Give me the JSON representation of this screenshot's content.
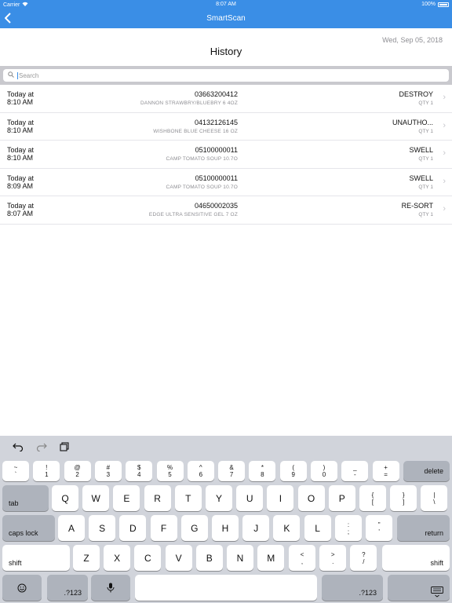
{
  "status_bar": {
    "carrier": "Carrier",
    "time": "8:07 AM",
    "battery": "100%"
  },
  "nav": {
    "title": "SmartScan",
    "back_icon": "chevron-left-icon"
  },
  "header": {
    "date": "Wed, Sep 05, 2018",
    "title": "History"
  },
  "search": {
    "placeholder": "Search"
  },
  "history": [
    {
      "when_line1": "Today at",
      "when_line2": "8:10 AM",
      "code": "03663200412",
      "desc": "DANNON STRAWBRY/BLUEBRY 6 4OZ",
      "status": "DESTROY",
      "qty": "QTY 1"
    },
    {
      "when_line1": "Today at",
      "when_line2": "8:10 AM",
      "code": "04132126145",
      "desc": "WISHBONE BLUE CHEESE 16 OZ",
      "status": "UNAUTHO...",
      "qty": "QTY 1"
    },
    {
      "when_line1": "Today at",
      "when_line2": "8:10 AM",
      "code": "05100000011",
      "desc": "CAMP TOMATO SOUP 10.7O",
      "status": "SWELL",
      "qty": "QTY 1"
    },
    {
      "when_line1": "Today at",
      "when_line2": "8:09 AM",
      "code": "05100000011",
      "desc": "CAMP TOMATO SOUP 10.7O",
      "status": "SWELL",
      "qty": "QTY 1"
    },
    {
      "when_line1": "Today at",
      "when_line2": "8:07 AM",
      "code": "04650002035",
      "desc": "EDGE ULTRA SENSITIVE GEL 7 OZ",
      "status": "RE-SORT",
      "qty": "QTY 1"
    }
  ],
  "keyboard": {
    "row1": [
      {
        "top": "~",
        "bottom": "`"
      },
      {
        "top": "!",
        "bottom": "1"
      },
      {
        "top": "@",
        "bottom": "2"
      },
      {
        "top": "#",
        "bottom": "3"
      },
      {
        "top": "$",
        "bottom": "4"
      },
      {
        "top": "%",
        "bottom": "5"
      },
      {
        "top": "^",
        "bottom": "6"
      },
      {
        "top": "&",
        "bottom": "7"
      },
      {
        "top": "*",
        "bottom": "8"
      },
      {
        "top": "(",
        "bottom": "9"
      },
      {
        "top": ")",
        "bottom": "0"
      },
      {
        "top": "_",
        "bottom": "-"
      },
      {
        "top": "+",
        "bottom": "="
      }
    ],
    "delete": "delete",
    "tab": "tab",
    "row2": [
      "Q",
      "W",
      "E",
      "R",
      "T",
      "Y",
      "U",
      "I",
      "O",
      "P"
    ],
    "row2_sym": [
      {
        "top": "{",
        "bottom": "["
      },
      {
        "top": "}",
        "bottom": "]"
      },
      {
        "top": "|",
        "bottom": "\\"
      }
    ],
    "caps": "caps lock",
    "row3": [
      "A",
      "S",
      "D",
      "F",
      "G",
      "H",
      "J",
      "K",
      "L"
    ],
    "row3_sym": [
      {
        "top": ":",
        "bottom": ";"
      },
      {
        "top": "\"",
        "bottom": "'"
      }
    ],
    "return": "return",
    "shift": "shift",
    "row4": [
      "Z",
      "X",
      "C",
      "V",
      "B",
      "N",
      "M"
    ],
    "row4_sym": [
      {
        "top": "<",
        "bottom": ","
      },
      {
        "top": ">",
        "bottom": "."
      },
      {
        "top": "?",
        "bottom": "/"
      }
    ],
    "num": ".?123"
  }
}
